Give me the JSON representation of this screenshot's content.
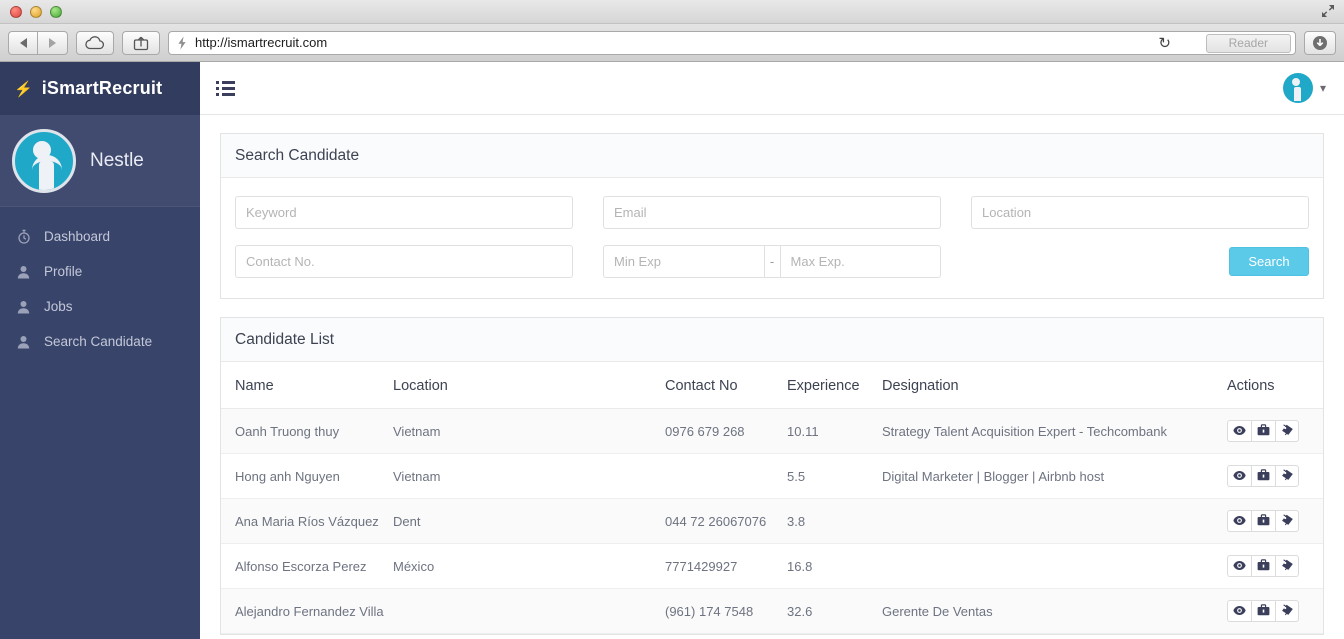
{
  "browser": {
    "url": "http://ismartrecruit.com",
    "reader_label": "Reader",
    "back_icon": "back-arrow-icon",
    "forward_icon": "forward-arrow-icon",
    "cloud_icon": "icloud-icon",
    "share_icon": "share-icon",
    "site_icon": "lightning-site-icon",
    "reload_icon": "reload-icon",
    "download_icon": "download-icon",
    "expand_icon": "fullscreen-icon"
  },
  "sidebar": {
    "brand": "iSmartRecruit",
    "brand_icon": "lightning-bolt-icon",
    "org_name": "Nestle",
    "avatar_icon": "user-avatar-icon",
    "items": [
      {
        "label": "Dashboard",
        "icon": "stopwatch-icon"
      },
      {
        "label": "Profile",
        "icon": "user-icon"
      },
      {
        "label": "Jobs",
        "icon": "user-icon"
      },
      {
        "label": "Search Candidate",
        "icon": "user-icon"
      }
    ]
  },
  "topbar": {
    "menu_icon": "hamburger-list-icon",
    "user_avatar_icon": "user-avatar-icon",
    "chevron_icon": "chevron-down-icon"
  },
  "search_panel": {
    "title": "Search Candidate",
    "keyword_placeholder": "Keyword",
    "email_placeholder": "Email",
    "location_placeholder": "Location",
    "contact_placeholder": "Contact No.",
    "min_exp_placeholder": "Min Exp",
    "exp_separator": "-",
    "max_exp_placeholder": "Max Exp.",
    "search_label": "Search"
  },
  "candidate_list": {
    "title": "Candidate List",
    "columns": [
      "Name",
      "Location",
      "Contact No",
      "Experience",
      "Designation",
      "Actions"
    ],
    "action_icons": [
      "eye-icon",
      "briefcase-icon",
      "tags-icon"
    ],
    "rows": [
      {
        "name": "Oanh Truong thuy",
        "location": "Vietnam",
        "contact": "0976 679 268",
        "experience": "10.11",
        "designation": "Strategy Talent Acquisition Expert - Techcombank"
      },
      {
        "name": "Hong anh Nguyen",
        "location": "Vietnam",
        "contact": "",
        "experience": "5.5",
        "designation": "Digital Marketer | Blogger | Airbnb host"
      },
      {
        "name": "Ana Maria Ríos Vázquez",
        "location": "Dent",
        "contact": "044 72 26067076",
        "experience": "3.8",
        "designation": ""
      },
      {
        "name": "Alfonso Escorza Perez",
        "location": "México",
        "contact": "7771429927",
        "experience": "16.8",
        "designation": ""
      },
      {
        "name": "Alejandro Fernandez Villa",
        "location": "",
        "contact": "(961) 174 7548",
        "experience": "32.6",
        "designation": "Gerente De Ventas"
      }
    ]
  },
  "colors": {
    "sidebar": "#39446a",
    "brand_bar": "#323c5e",
    "accent": "#5bc9e8",
    "avatar": "#20a8c8"
  }
}
